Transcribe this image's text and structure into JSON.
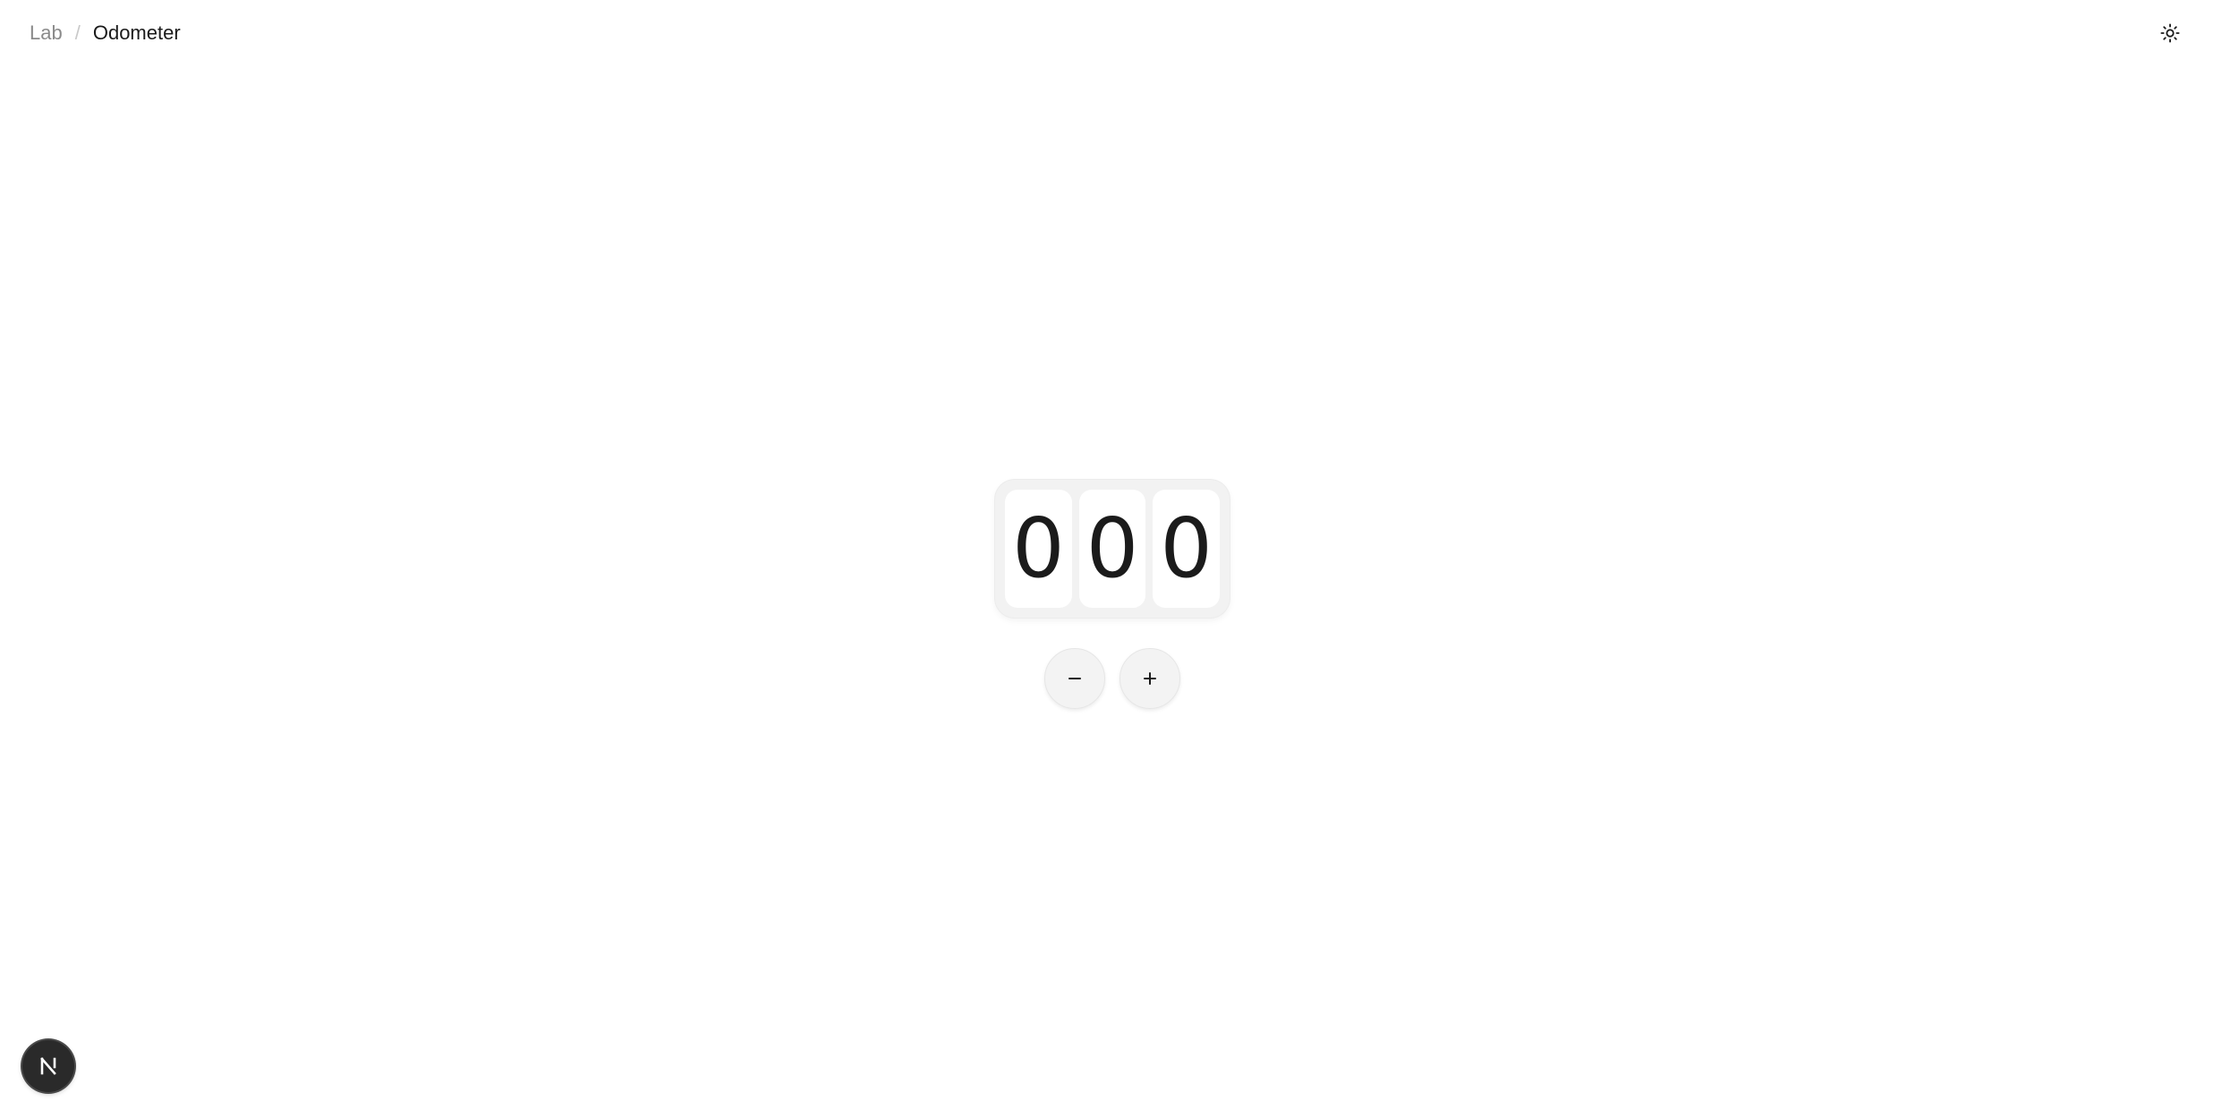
{
  "breadcrumb": {
    "parent": "Lab",
    "separator": "/",
    "current": "Odometer"
  },
  "theme_toggle": {
    "icon": "sun-icon"
  },
  "odometer": {
    "value": 0,
    "digits": [
      "0",
      "0",
      "0"
    ]
  },
  "controls": {
    "decrement_icon": "minus-icon",
    "increment_icon": "plus-icon"
  },
  "badge": {
    "icon": "nextjs-n-icon"
  },
  "colors": {
    "background": "#ffffff",
    "text_primary": "#1a1a1a",
    "text_muted": "#8a8a8a",
    "odometer_frame": "#f2f2f2",
    "digit_face": "#ffffff",
    "badge": "#2a2a2a"
  }
}
